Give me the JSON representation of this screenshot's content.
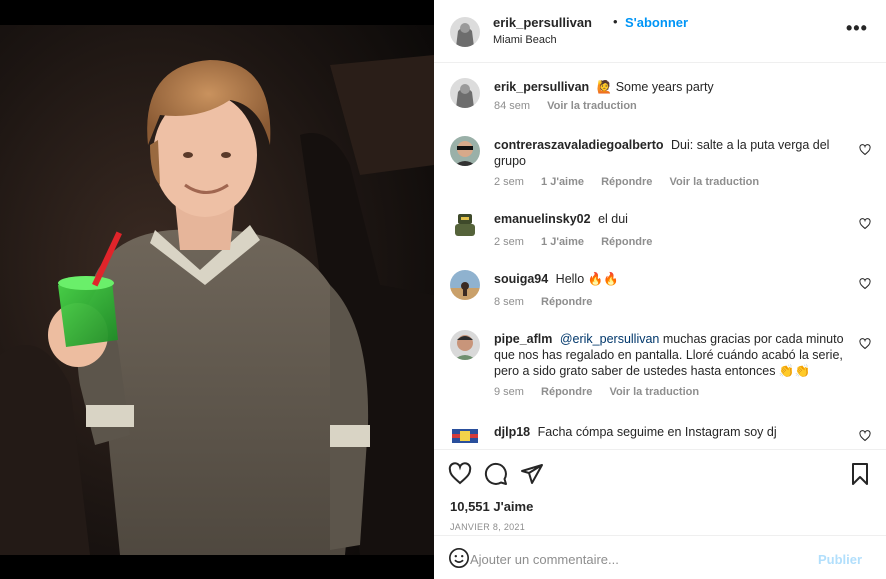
{
  "post": {
    "author": "erik_persullivan",
    "follow_label": "S'abonner",
    "separator": "•",
    "location": "Miami Beach",
    "more_label": "•••"
  },
  "caption": {
    "user": "erik_persullivan",
    "text": "🙋 Some years party",
    "time": "84 sem",
    "translate": "Voir la traduction"
  },
  "comments": [
    {
      "user": "contrerasza valadiegoalberto",
      "text": "Dui: salte a la puta verga del grupo",
      "time": "2 sem",
      "likes": "1 J'aime",
      "reply": "Répondre",
      "translate": "Voir la traduction"
    },
    {
      "user": "emanuelinsky02",
      "text": "el dui",
      "time": "2 sem",
      "likes": "1 J'aime",
      "reply": "Répondre"
    },
    {
      "user": "souiga94",
      "text": "Hello 🔥🔥",
      "time": "8 sem",
      "reply": "Répondre"
    },
    {
      "user": "pipe_aflm",
      "mention": "@erik_persullivan",
      "text": "muchas gracias por cada minuto que nos has regalado en pantalla. Lloré cuándo acabó la serie, pero a sido grato saber de ustedes hasta entonces 👏👏",
      "time": "9 sem",
      "reply": "Répondre",
      "translate": "Voir la traduction"
    },
    {
      "user": "djlp18",
      "text": "Facha cómpa seguime en Instagram soy dj"
    }
  ],
  "actions": {
    "likes": "10,551 J'aime",
    "date": "JANVIER 8, 2021"
  },
  "add_comment": {
    "placeholder": "Ajouter un commentaire...",
    "publish": "Publier"
  },
  "icons": [
    "heart-icon",
    "comment-icon",
    "share-icon",
    "bookmark-icon",
    "emoji-icon",
    "more-icon"
  ],
  "colors": {
    "accent": "#0095f6",
    "muted": "#8e8e8e",
    "publish_disabled": "#b2dffc"
  }
}
